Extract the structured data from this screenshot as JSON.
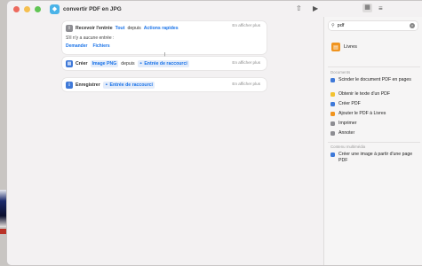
{
  "window": {
    "title": "convertir PDF en JPG"
  },
  "editor": {
    "action1": {
      "name": "Recevoir l'entrée",
      "token_type": "Tout",
      "connector": "depuis",
      "token_source": "Actions rapides",
      "show_more": "En afficher plus",
      "no_input_text": "S'il n'y a aucune entrée :",
      "button_ask": "Demander",
      "button_files": "Fichiers"
    },
    "action2": {
      "name": "Créer",
      "token_type": "Image PNG",
      "connector": "depuis",
      "token_source": "Entrée de raccourci",
      "show_more": "En afficher plus"
    },
    "action3": {
      "name": "Enregistrer",
      "token_source": "Entrée de raccourci",
      "show_more": "En afficher plus"
    }
  },
  "sidebar": {
    "search": {
      "value": "pdf"
    },
    "app_result": "Livres",
    "section_documents": "Documents",
    "documents": [
      {
        "label": "Scinder le document PDF en pages",
        "color": "#3f79d8"
      },
      {
        "label": "Obtenir le texte d'un PDF",
        "color": "#f2c232"
      },
      {
        "label": "Créer PDF",
        "color": "#3f79d8"
      },
      {
        "label": "Ajouter le PDF à Livres",
        "color": "#f0941f"
      },
      {
        "label": "Imprimer",
        "color": "#8d8d92"
      },
      {
        "label": "Annoter",
        "color": "#8d8d92"
      }
    ],
    "section_multimedia": "Contenu multimédia",
    "multimedia": [
      {
        "label": "Créer une image à partir d'une page PDF",
        "color": "#3f79d8"
      }
    ]
  }
}
